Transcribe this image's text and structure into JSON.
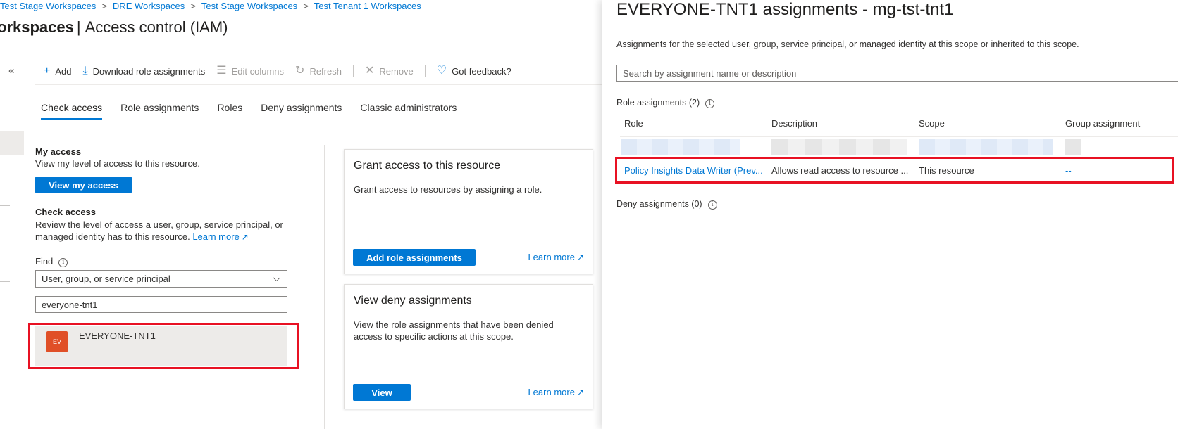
{
  "breadcrumb": {
    "items": [
      "Test Stage Workspaces",
      "DRE Workspaces",
      "Test Stage Workspaces",
      "Test Tenant 1 Workspaces"
    ],
    "separator": ">"
  },
  "page_title": {
    "name": "orkspaces",
    "section": "Access control (IAM)"
  },
  "collapse_label": "«",
  "toolbar": {
    "add": "Add",
    "download": "Download role assignments",
    "edit_columns": "Edit columns",
    "refresh": "Refresh",
    "remove": "Remove",
    "feedback": "Got feedback?"
  },
  "tabs": [
    "Check access",
    "Role assignments",
    "Roles",
    "Deny assignments",
    "Classic administrators"
  ],
  "my_access": {
    "heading": "My access",
    "description": "View my level of access to this resource.",
    "button": "View my access"
  },
  "check_access": {
    "heading": "Check access",
    "description": "Review the level of access a user, group, service principal, or managed identity has to this resource.",
    "learn_more": "Learn more",
    "find_label": "Find",
    "find_select_value": "User, group, or service principal",
    "search_value": "everyone-tnt1",
    "result": {
      "avatar_initials": "EV",
      "name": "EVERYONE-TNT1"
    }
  },
  "grant_card": {
    "title": "Grant access to this resource",
    "description": "Grant access to resources by assigning a role.",
    "button": "Add role assignments",
    "learn_more": "Learn more"
  },
  "deny_card": {
    "title": "View deny assignments",
    "description": "View the role assignments that have been denied access to specific actions at this scope.",
    "button": "View",
    "learn_more": "Learn more"
  },
  "panel": {
    "title": "EVERYONE-TNT1 assignments - mg-tst-tnt1",
    "description": "Assignments for the selected user, group, service principal, or managed identity at this scope or inherited to this scope.",
    "search_placeholder": "Search by assignment name or description",
    "role_assignments_label": "Role assignments (2)",
    "columns": [
      "Role",
      "Description",
      "Scope",
      "Group assignment"
    ],
    "row": {
      "role": "Policy Insights Data Writer (Prev...",
      "description": "Allows read access to resource ...",
      "scope": "This resource",
      "group_assignment": "--"
    },
    "deny_assignments_label": "Deny assignments (0)"
  },
  "colors": {
    "accent": "#0078d4",
    "highlight": "#e81123",
    "avatar": "#e04f27"
  }
}
